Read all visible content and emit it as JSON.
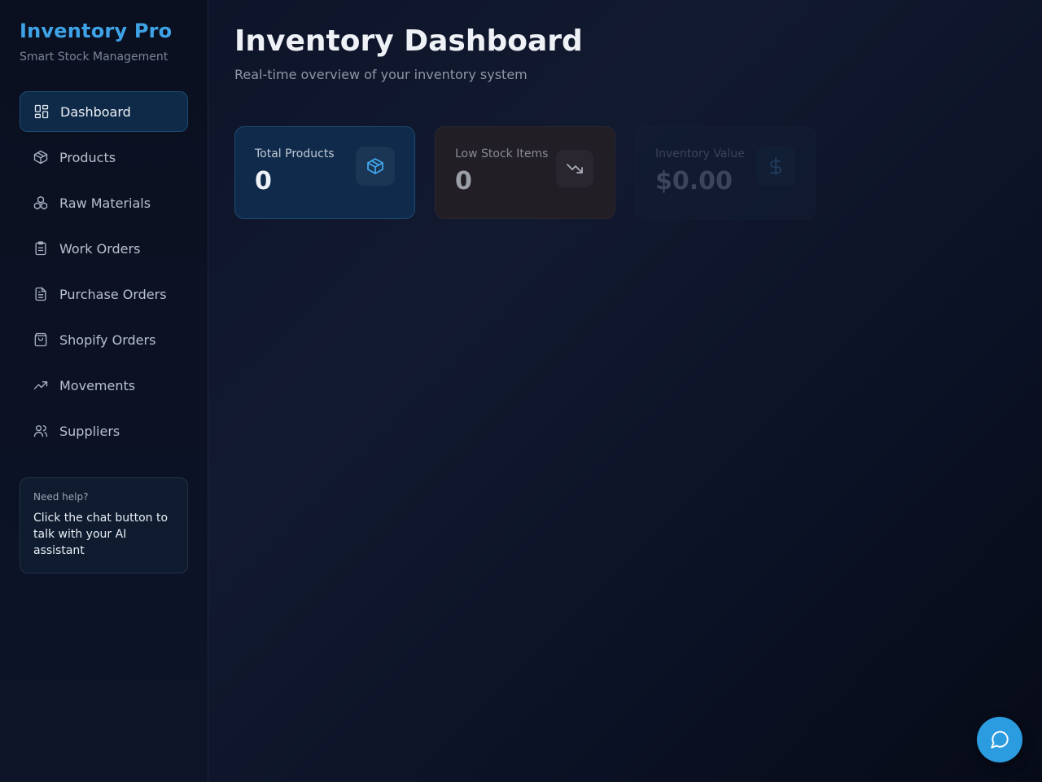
{
  "brand": {
    "title": "Inventory Pro",
    "subtitle": "Smart Stock Management",
    "accent_color": "#3ea3e6"
  },
  "sidebar": {
    "items": [
      {
        "label": "Dashboard",
        "icon": "layout-grid-icon",
        "active": true
      },
      {
        "label": "Products",
        "icon": "package-icon",
        "active": false
      },
      {
        "label": "Raw Materials",
        "icon": "boxes-icon",
        "active": false
      },
      {
        "label": "Work Orders",
        "icon": "clipboard-icon",
        "active": false
      },
      {
        "label": "Purchase Orders",
        "icon": "file-text-icon",
        "active": false
      },
      {
        "label": "Shopify Orders",
        "icon": "shopping-bag-icon",
        "active": false
      },
      {
        "label": "Movements",
        "icon": "trending-up-icon",
        "active": false
      },
      {
        "label": "Suppliers",
        "icon": "users-icon",
        "active": false
      }
    ],
    "help": {
      "title": "Need help?",
      "text": "Click the chat button to talk with your AI assistant"
    }
  },
  "main": {
    "title": "Inventory Dashboard",
    "subtitle": "Real-time overview of your inventory system",
    "cards": [
      {
        "label": "Total Products",
        "value": "0",
        "icon": "package-icon"
      },
      {
        "label": "Low Stock Items",
        "value": "0",
        "icon": "trending-down-icon"
      },
      {
        "label": "Inventory Value",
        "value": "$0.00",
        "icon": "dollar-icon"
      }
    ]
  },
  "chat": {
    "icon": "message-circle-icon",
    "color": "#2b9ce0"
  }
}
